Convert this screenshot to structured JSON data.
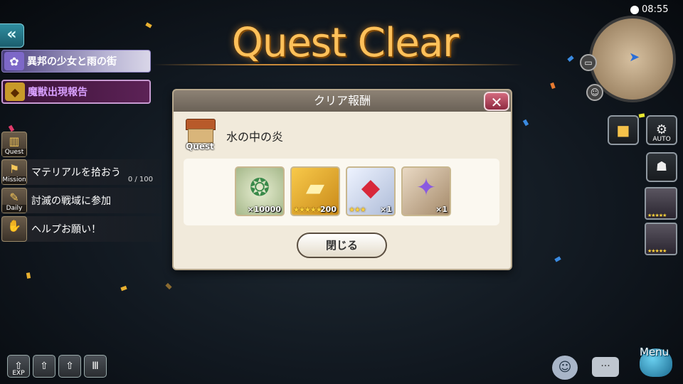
{
  "title": "Quest Clear",
  "clock": "08:55",
  "left_panel": {
    "back_icon": "double-chevron-left-icon",
    "banner1": "異邦の少女と雨の街",
    "banner2": "魔獣出現報告",
    "missions": [
      {
        "tag": "Quest",
        "label": "",
        "progress": ""
      },
      {
        "tag": "Mission",
        "label": "マテリアルを拾おう",
        "progress": "0 / 100"
      },
      {
        "tag": "Daily",
        "label": "討滅の戦域に参加",
        "progress": ""
      },
      {
        "tag": "",
        "label": "ヘルプお願い！",
        "progress": ""
      }
    ]
  },
  "dialog": {
    "header": "クリア報酬",
    "close_x": "✕",
    "quest_tag": "Quest",
    "quest_name": "水の中の炎",
    "rewards": [
      {
        "name": "coin",
        "qty": "×10000",
        "stars": ""
      },
      {
        "name": "gold-ingot",
        "qty": "200",
        "stars": "★★★★★"
      },
      {
        "name": "red-crystal",
        "qty": "×1",
        "stars": "★★★"
      },
      {
        "name": "purple-gem-emblem",
        "qty": "×1",
        "stars": ""
      }
    ],
    "close_button": "閉じる"
  },
  "right_panel": {
    "auto_label": "AUTO"
  },
  "bottom_bar": {
    "exp_label": "EXP",
    "menu_label": "Menu"
  },
  "colors": {
    "title_gold": "#ffc15a",
    "dialog_bg": "#f1eadb",
    "close_red": "#b8475e"
  }
}
